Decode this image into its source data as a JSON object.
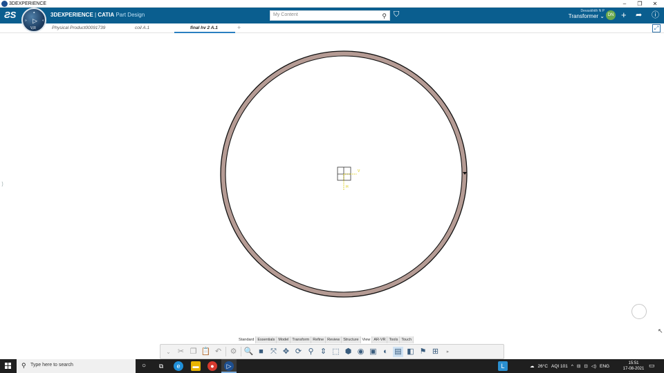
{
  "os_window": {
    "title": "3DEXPERIENCE",
    "controls": [
      "–",
      "❐",
      "✕"
    ]
  },
  "topbar": {
    "brand_main": "3DEXPERIENCE",
    "brand_sep": " | ",
    "brand_catia": "CATIA",
    "brand_app": " Part Design",
    "compass_label": "V,R",
    "search_placeholder": "My Content",
    "user_name": "Devaskhith N P",
    "context": "Transformer ⌄",
    "avatar_initials": "DN"
  },
  "tabs": [
    {
      "label": "Physical Product00091739",
      "active": false
    },
    {
      "label": "coil A.1",
      "active": false
    },
    {
      "label": "final hv 2 A.1",
      "active": true
    }
  ],
  "tab_add": "+",
  "model": {
    "ring_fill": "#b59b94",
    "ring_stroke": "#111111",
    "axis_color": "#d8c800",
    "axis_h_label": "V",
    "axis_v_label": "H"
  },
  "command_tabs": [
    {
      "label": "Standard",
      "active": true
    },
    {
      "label": "Essentials",
      "active": false
    },
    {
      "label": "Model",
      "active": false
    },
    {
      "label": "Transform",
      "active": false
    },
    {
      "label": "Refine",
      "active": false
    },
    {
      "label": "Review",
      "active": false
    },
    {
      "label": "Structure",
      "active": false
    },
    {
      "label": "View",
      "active": true
    },
    {
      "label": "AR-VR",
      "active": false
    },
    {
      "label": "Tools",
      "active": false
    },
    {
      "label": "Touch",
      "active": false
    }
  ],
  "taskbar": {
    "search_placeholder": "Type here to search",
    "weather": "26°C",
    "aqi": "AQI 101",
    "language": "ENG",
    "time": "15:51",
    "date": "17-08-2021"
  }
}
